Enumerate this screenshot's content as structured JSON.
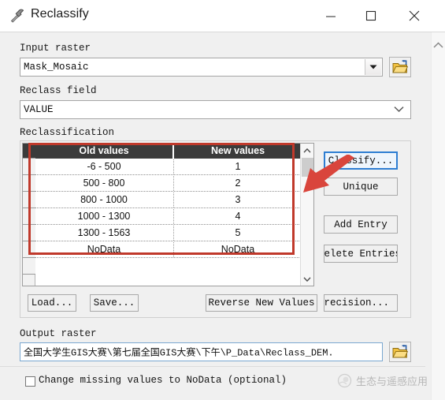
{
  "window": {
    "title": "Reclassify",
    "icon": "hammer-tool-icon",
    "controls": {
      "minimize": "minimize-icon",
      "maximize": "maximize-icon",
      "close": "close-icon"
    }
  },
  "form": {
    "input_raster": {
      "label": "Input raster",
      "value": "Mask_Mosaic",
      "browse_icon": "open-folder-icon"
    },
    "reclass_field": {
      "label": "Reclass field",
      "value": "VALUE"
    },
    "reclassification": {
      "label": "Reclassification",
      "columns": [
        "Old values",
        "New values"
      ],
      "rows": [
        {
          "old": "-6 - 500",
          "new": "1"
        },
        {
          "old": "500 - 800",
          "new": "2"
        },
        {
          "old": "800 - 1000",
          "new": "3"
        },
        {
          "old": "1000 - 1300",
          "new": "4"
        },
        {
          "old": "1300 - 1563",
          "new": "5"
        },
        {
          "old": "NoData",
          "new": "NoData"
        }
      ]
    },
    "side_buttons": {
      "classify": "Classify...",
      "unique": "Unique",
      "add_entry": "Add Entry",
      "delete_entries": "Delete Entries"
    },
    "table_buttons": {
      "load": "Load...",
      "save": "Save...",
      "reverse": "Reverse New Values",
      "precision": "Precision..."
    },
    "output_raster": {
      "label": "Output raster",
      "value": "全国大学生GIS大赛\\第七届全国GIS大赛\\下午\\P_Data\\Reclass_DEM.",
      "browse_icon": "open-folder-icon"
    },
    "change_missing": {
      "label": "Change missing values to NoData (optional)",
      "checked": false
    }
  },
  "watermark": {
    "text": "生态与遥感应用",
    "icon": "circular-logo-icon"
  },
  "annotation": {
    "highlight_target": "reclassification-table",
    "arrow_from": "classify-button",
    "color": "#c0392b"
  },
  "colors": {
    "dialog_bg": "#f0f0f0",
    "header_bg": "#3b3b3b",
    "accent": "#2d7dd2",
    "annotation": "#c0392b"
  }
}
